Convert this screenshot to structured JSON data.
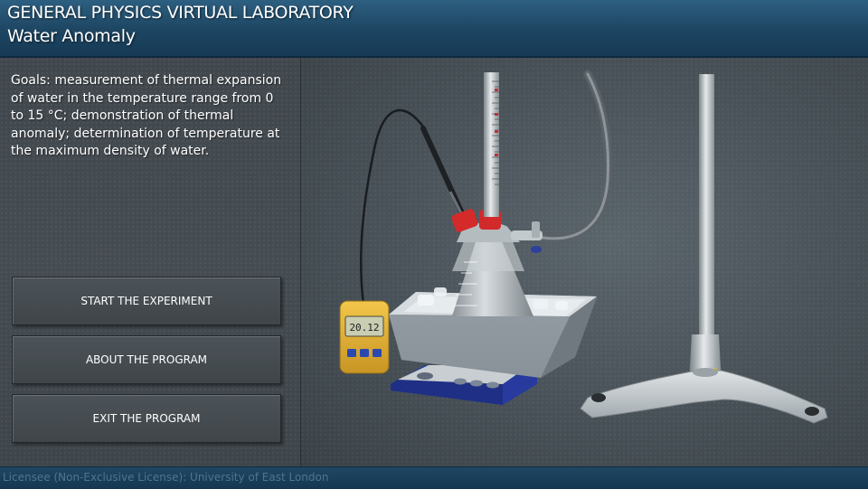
{
  "header": {
    "app_title": "GENERAL PHYSICS VIRTUAL LABORATORY",
    "subtitle": "Water Anomaly"
  },
  "goals": {
    "text": "Goals: measurement of thermal expansion of water in the temperature range from 0 to 15 °C; demonstration of thermal anomaly; determination of temperature at the maximum density of water."
  },
  "menu": {
    "start": "START THE EXPERIMENT",
    "about": "ABOUT THE PROGRAM",
    "exit": "EXIT THE PROGRAM"
  },
  "thermometer": {
    "reading": "20.12"
  },
  "footer": {
    "license": "Licensee (Non-Exclusive License): University of East London"
  }
}
